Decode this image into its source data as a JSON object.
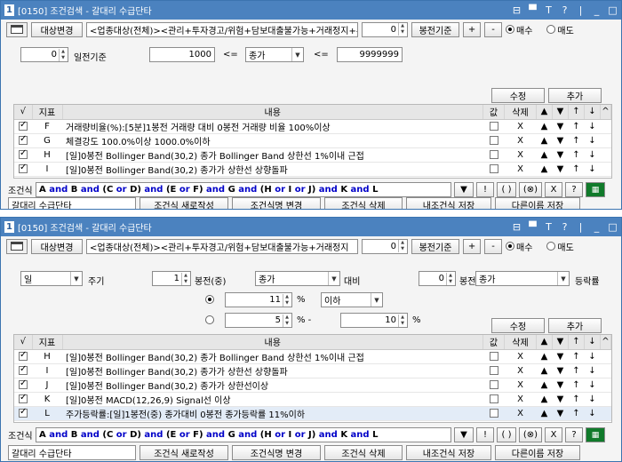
{
  "w1": {
    "num": "1",
    "title": "[0150] 조건검색 - 갈대리 수급단타",
    "controls": [
      "⊟",
      "▀",
      "T",
      "?",
      "|",
      "_",
      "□"
    ],
    "toolbar": {
      "target_btn": "대상변경",
      "target_text": "<업종대상(전체)><관리+투자경고/위험+담보대출불가능+거래정지+투자주의+",
      "count": "0",
      "base_btn": "봉전기준",
      "plus": "+",
      "minus": "-",
      "radio_buy": "매수",
      "radio_sell": "매도"
    },
    "days_value": "0",
    "days_label": "일전기준",
    "range_min": "1000",
    "lte1": "<=",
    "price_field": "종가",
    "lte2": "<=",
    "range_max": "9999999",
    "edit_btn": "수정",
    "add_btn": "추가",
    "columns": [
      "√",
      "지표",
      "내용",
      "값",
      "삭제",
      "▲",
      "▼",
      "↑",
      "↓"
    ],
    "rows": [
      {
        "checked": true,
        "key": "F",
        "text": "거래량비율(%):[5분]1봉전 거래량 대비 0봉전 거래량 비율 100%이상",
        "del": "X"
      },
      {
        "checked": true,
        "key": "G",
        "text": "체결강도 100.0%이상 1000.0%이하",
        "del": "X"
      },
      {
        "checked": true,
        "key": "H",
        "text": "[일]0봉전 Bollinger Band(30,2) 종가 Bollinger Band 상한선 1%이내 근접",
        "del": "X"
      },
      {
        "checked": true,
        "key": "I",
        "text": "[일]0봉전 Bollinger Band(30,2) 종가가 상한선 상향돌파",
        "del": "X"
      },
      {
        "checked": true,
        "key": "J",
        "text": "[일]0봉전 Bollinger Band(30,2) 종가가 상한선이상",
        "del": "X"
      }
    ],
    "cond_label": "조건식",
    "cond_tokens": [
      {
        "t": "A",
        "kw": false
      },
      {
        "t": " and ",
        "kw": true
      },
      {
        "t": "B",
        "kw": false
      },
      {
        "t": " and ",
        "kw": true
      },
      {
        "t": "(",
        "kw": false
      },
      {
        "t": "C",
        "kw": false
      },
      {
        "t": " or ",
        "kw": true
      },
      {
        "t": "D",
        "kw": false
      },
      {
        "t": ")",
        "kw": false
      },
      {
        "t": " and ",
        "kw": true
      },
      {
        "t": "(",
        "kw": false
      },
      {
        "t": "E",
        "kw": false
      },
      {
        "t": " or ",
        "kw": true
      },
      {
        "t": "F",
        "kw": false
      },
      {
        "t": ")",
        "kw": false
      },
      {
        "t": " and ",
        "kw": true
      },
      {
        "t": "G",
        "kw": false
      },
      {
        "t": " and ",
        "kw": true
      },
      {
        "t": "(",
        "kw": false
      },
      {
        "t": "H",
        "kw": false
      },
      {
        "t": " or ",
        "kw": true
      },
      {
        "t": "I",
        "kw": false
      },
      {
        "t": " or ",
        "kw": true
      },
      {
        "t": "J",
        "kw": false
      },
      {
        "t": ")",
        "kw": false
      },
      {
        "t": " and ",
        "kw": true
      },
      {
        "t": "K",
        "kw": false
      },
      {
        "t": " and ",
        "kw": true
      },
      {
        "t": "L",
        "kw": false
      }
    ],
    "cond_btns": [
      "▼",
      "!",
      "( )",
      "(⊗)",
      "X",
      "?"
    ],
    "name": "갈대리 수급단타",
    "bottom_btns": [
      "조건식 새로작성",
      "조건식명 변경",
      "조건식 삭제",
      "내조건식 저장",
      "다른이름 저장"
    ]
  },
  "w2": {
    "num": "1",
    "title": "[0150] 조건검색 - 갈대리 수급단타",
    "controls": [
      "⊟",
      "▀",
      "T",
      "?",
      "|",
      "_",
      "□"
    ],
    "toolbar": {
      "target_btn": "대상변경",
      "target_text": "<업종대상(전체)><관리+투자경고/위험+담보대출불가능+거래정지",
      "count": "0",
      "base_btn": "봉전기준",
      "plus": "+",
      "minus": "-",
      "radio_buy": "매수",
      "radio_sell": "매도"
    },
    "period_value": "일",
    "period_label": "주기",
    "bong_value": "1",
    "bong_label": "봉전(중)",
    "price_field": "종가",
    "compare_label": "대비",
    "bong2_value": "0",
    "bong2_label": "봉전",
    "price_field2": "종가",
    "rate_label": "등락률",
    "pct1_value": "11",
    "pct1_unit": "%",
    "pct1_cond": "이하",
    "pct2_value": "5",
    "pct2_unit": "% -",
    "pct3_value": "10",
    "pct3_unit": "%",
    "edit_btn": "수정",
    "add_btn": "추가",
    "columns": [
      "√",
      "지표",
      "내용",
      "값",
      "삭제",
      "▲",
      "▼",
      "↑",
      "↓"
    ],
    "rows": [
      {
        "checked": true,
        "key": "H",
        "text": "[일]0봉전 Bollinger Band(30,2) 종가 Bollinger Band 상한선 1%이내 근접",
        "del": "X"
      },
      {
        "checked": true,
        "key": "I",
        "text": "[일]0봉전 Bollinger Band(30,2) 종가가 상한선 상향돌파",
        "del": "X"
      },
      {
        "checked": true,
        "key": "J",
        "text": "[일]0봉전 Bollinger Band(30,2) 종가가 상한선이상",
        "del": "X"
      },
      {
        "checked": true,
        "key": "K",
        "text": "[일]0봉전 MACD(12,26,9) Signal선 이상",
        "del": "X"
      },
      {
        "checked": true,
        "key": "L",
        "text": "주가등락률:[일]1봉전(중) 종가대비 0봉전 종가등락률 11%이하",
        "del": "X"
      }
    ],
    "cond_label": "조건식",
    "name": "갈대리 수급단타",
    "bottom_btns": [
      "조건식 새로작성",
      "조건식명 변경",
      "조건식 삭제",
      "내조건식 저장",
      "다른이름 저장"
    ]
  }
}
